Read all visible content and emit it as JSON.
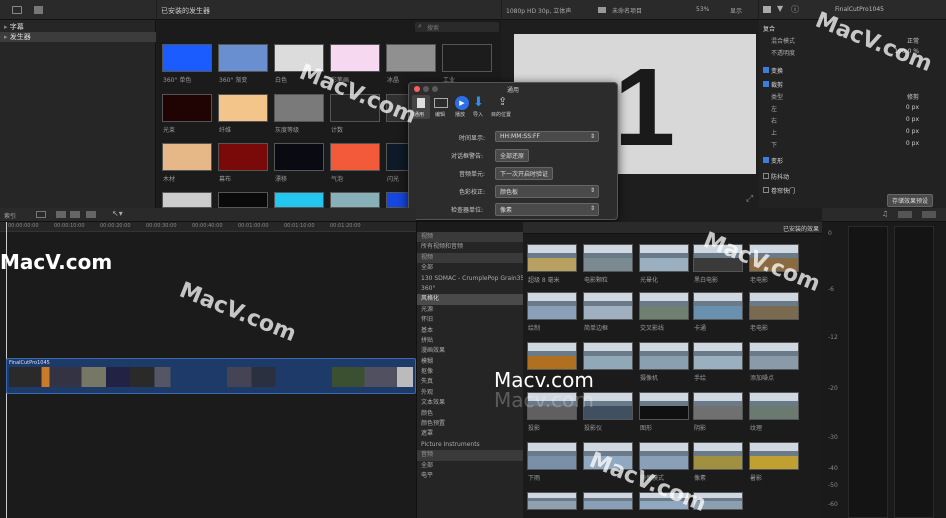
{
  "libraries": {
    "captions": "字幕",
    "generators": "发生器"
  },
  "gen_browser": {
    "title": "已安装的发生器",
    "search_placeholder": "搜索",
    "items": [
      {
        "label": "360° 单色",
        "color": "#1a5cff"
      },
      {
        "label": "360° 渐变",
        "color": "#6a8fd0"
      },
      {
        "label": "白色",
        "color": "#dcdcdc"
      },
      {
        "label": "彩笔画",
        "color": "#f6d8f0"
      },
      {
        "label": "冰晶",
        "color": "#909090"
      },
      {
        "label": "工业",
        "color": "#1c1c1c"
      },
      {
        "label": "光束",
        "color": "#200404"
      },
      {
        "label": "纤维",
        "color": "#f3c58a"
      },
      {
        "label": "灰度等级",
        "color": "#7a7a7a"
      },
      {
        "label": "计数",
        "color": "#222222"
      },
      {
        "label": "",
        "color": "#303030"
      },
      {
        "label": "",
        "color": "#252525"
      },
      {
        "label": "木材",
        "color": "#e6b888"
      },
      {
        "label": "幕布",
        "color": "#7a0a0a"
      },
      {
        "label": "漂移",
        "color": "#0a0a12"
      },
      {
        "label": "气泡",
        "color": "#f25a3a"
      },
      {
        "label": "闪光",
        "color": "#0e1a28"
      },
      {
        "label": "",
        "color": "#202020"
      },
      {
        "label": "",
        "color": "#cccccc"
      },
      {
        "label": "",
        "color": "#0a0a0a"
      },
      {
        "label": "",
        "color": "#22c6ef"
      },
      {
        "label": "",
        "color": "#88b0b8"
      },
      {
        "label": "",
        "color": "#1546e0"
      },
      {
        "label": "",
        "color": "#202020"
      }
    ]
  },
  "viewer": {
    "format": "1080p HD 30p, 立体声",
    "project": "未命名项目",
    "zoom": "53%",
    "view": "显示",
    "big_digit": "1"
  },
  "inspector": {
    "clip_name": "FinalCutPro1045",
    "composite": "复合",
    "blend_label": "混合模式",
    "blend_value": "正常",
    "opacity_label": "不透明度",
    "opacity_value": "100.0 %",
    "transform": "变换",
    "crop": "裁剪",
    "type_label": "类型",
    "type_value": "修剪",
    "left": "左",
    "right": "右",
    "top": "上",
    "bottom": "下",
    "zero": "0 px",
    "distort": "变形",
    "stabilize": "防抖动",
    "rolling": "卷帘快门",
    "save_preset": "存储效果预设"
  },
  "dialog": {
    "title": "通用",
    "tabs": [
      "通用",
      "编辑",
      "播放",
      "导入",
      "目的位置"
    ],
    "time_label": "时间显示:",
    "time_value": "HH:MM:SS:FF",
    "warn_label": "对话框警告:",
    "warn_button": "全部还原",
    "audio_label": "音频单元:",
    "audio_button": "下一次开启时验证",
    "color_label": "色彩校正:",
    "color_value": "颜色板",
    "scope_label": "检查器单位:",
    "scope_value": "像素"
  },
  "timeline": {
    "index": "索引",
    "times": [
      "00:00:00:00",
      "00:00:10:00",
      "00:00:20:00",
      "00:00:30:00",
      "00:00:40:00",
      "00:01:00:00",
      "00:01:10:00",
      "00:01:20:00"
    ],
    "clip": "FinalCutPro1045"
  },
  "effects": {
    "header": "已安装的效果",
    "categories": [
      {
        "label": "视频",
        "type": "sec"
      },
      {
        "label": "所有视频和音频",
        "type": ""
      },
      {
        "label": "视频",
        "type": "sec"
      },
      {
        "label": "全部",
        "type": ""
      },
      {
        "label": "130 SDMAC - CrumplePop Grain35...",
        "type": ""
      },
      {
        "label": "360°",
        "type": ""
      },
      {
        "label": "风格化",
        "type": "sel"
      },
      {
        "label": "光源",
        "type": ""
      },
      {
        "label": "怀旧",
        "type": ""
      },
      {
        "label": "基本",
        "type": ""
      },
      {
        "label": "拼贴",
        "type": ""
      },
      {
        "label": "漫画效果",
        "type": ""
      },
      {
        "label": "模糊",
        "type": ""
      },
      {
        "label": "抠像",
        "type": ""
      },
      {
        "label": "失真",
        "type": ""
      },
      {
        "label": "外观",
        "type": ""
      },
      {
        "label": "文本效果",
        "type": ""
      },
      {
        "label": "颜色",
        "type": ""
      },
      {
        "label": "颜色预置",
        "type": ""
      },
      {
        "label": "遮罩",
        "type": ""
      },
      {
        "label": "Picture Instruments",
        "type": ""
      },
      {
        "label": "音频",
        "type": "sec"
      },
      {
        "label": "全部",
        "type": ""
      },
      {
        "label": "电平",
        "type": ""
      }
    ],
    "items": [
      {
        "label": "超级 8 毫米",
        "tint": "#b8a060"
      },
      {
        "label": "电影颗粒",
        "tint": "#7a8a90"
      },
      {
        "label": "光晕化",
        "tint": "#9ab0c0"
      },
      {
        "label": "黑白电影",
        "tint": "#3a3a3a"
      },
      {
        "label": "老电影",
        "tint": "#8a6a40"
      },
      {
        "label": "绘制",
        "tint": "#8aa0b8"
      },
      {
        "label": "简单边框",
        "tint": "#a0b0c0"
      },
      {
        "label": "交叉影线",
        "tint": "#708070"
      },
      {
        "label": "卡通",
        "tint": "#6a90b0"
      },
      {
        "label": "老电影",
        "tint": "#7a6a50"
      },
      {
        "label": "",
        "tint": "#b07020"
      },
      {
        "label": "",
        "tint": "#90a8b8"
      },
      {
        "label": "摄像机",
        "tint": "#8aa0b0"
      },
      {
        "label": "手绘",
        "tint": "#9ab0c0"
      },
      {
        "label": "添加噪点",
        "tint": "#8a9aa8"
      },
      {
        "label": "投影",
        "tint": "#606060"
      },
      {
        "label": "投影仪",
        "tint": "#405060"
      },
      {
        "label": "图形",
        "tint": "#101010"
      },
      {
        "label": "阴影",
        "tint": "#707070"
      },
      {
        "label": "纹理",
        "tint": "#6a7a70"
      },
      {
        "label": "下雨",
        "tint": "#7a90a8"
      },
      {
        "label": "",
        "tint": "#90a8c0"
      },
      {
        "label": "镜像模式",
        "tint": "#8aa0b8"
      },
      {
        "label": "像素",
        "tint": "#a09040"
      },
      {
        "label": "暑影",
        "tint": "#c0a030"
      },
      {
        "label": "",
        "tint": "#90a0b0"
      },
      {
        "label": "",
        "tint": "#8aa0b8"
      },
      {
        "label": "",
        "tint": "#90a8c0"
      },
      {
        "label": "",
        "tint": "#8aa0b0"
      }
    ]
  },
  "meter": {
    "scale": [
      "0",
      "-6",
      "-12",
      "-20",
      "-30",
      "-40",
      "-50",
      "-60"
    ]
  },
  "watermarks": [
    "MacV.com",
    "MacV.com",
    "MacV.com",
    "MacV.com",
    "Macv.com",
    "Macv.com",
    "MacV.com",
    "MacV.com"
  ]
}
